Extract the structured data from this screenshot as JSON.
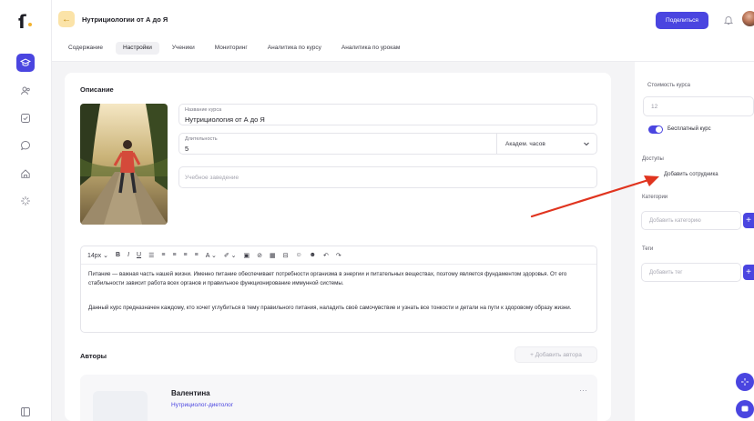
{
  "app": {
    "logo_glyph": "ſ",
    "accent_color": "#4a45e0",
    "highlight_color": "#f2b22e"
  },
  "sidebar": {
    "items": [
      {
        "icon": "graduation-cap-icon",
        "active": true
      },
      {
        "icon": "users-icon",
        "active": false
      },
      {
        "icon": "checkbox-icon",
        "active": false
      },
      {
        "icon": "chat-icon",
        "active": false
      },
      {
        "icon": "home-icon",
        "active": false
      },
      {
        "icon": "sparkles-icon",
        "active": false
      }
    ],
    "bottom_icon": "panel-toggle-icon"
  },
  "header": {
    "back_glyph": "←",
    "title": "Нутрициологии от А до Я",
    "share_label": "Поделиться",
    "bell_icon": "bell-icon",
    "avatar_icon": "user-avatar"
  },
  "tabs": [
    {
      "label": "Содержание",
      "active": false
    },
    {
      "label": "Настройки",
      "active": true
    },
    {
      "label": "Ученики",
      "active": false
    },
    {
      "label": "Мониторинг",
      "active": false
    },
    {
      "label": "Аналитика по курсу",
      "active": false
    },
    {
      "label": "Аналитика по урокам",
      "active": false
    }
  ],
  "description": {
    "section_title": "Описание",
    "course_name": {
      "label": "Название курса",
      "value": "Нутрициология от А до Я"
    },
    "duration": {
      "label": "Длительность",
      "value": "5",
      "unit": "Академ. часов"
    },
    "institution": {
      "placeholder": "Учебное заведение"
    },
    "toolbar": {
      "font_size": "14px ⌄",
      "bold": "B",
      "italic": "I",
      "underline": "U",
      "list": "☰",
      "align_left": "≡",
      "align_center": "≡",
      "align_right": "≡",
      "justify": "≡",
      "text_color": "A ⌄",
      "highlight": "✐ ⌄",
      "image": "▣",
      "link": "⊘",
      "table": "▦",
      "video": "⊟",
      "emoji1": "☺",
      "emoji2": "☻",
      "undo": "↶",
      "redo": "↷"
    },
    "text": {
      "p1": "Питание — важная часть нашей жизни. Именно питание обеспечивает потребности организма в энергии и питательных веществах, поэтому является фундаментом здоровья. От его стабильности зависит работа всех органов и правильное функционирование иммунной системы.",
      "p2": "Данный курс предназначен каждому, кто хочет углубиться в тему правильного питания, наладить своё самочувствие и узнать все тонкости и детали на пути к здоровому образу жизни."
    }
  },
  "authors": {
    "section_title": "Авторы",
    "add_label": "+ Добавить автора",
    "items": [
      {
        "name": "Валентина",
        "role": "Нутрициолог-диетолог",
        "more": "···"
      }
    ]
  },
  "right_panel": {
    "price": {
      "label": "Стоимость курса",
      "value": "12"
    },
    "free_course": {
      "label": "Бесплатный курс",
      "checked": true
    },
    "access": {
      "label": "Доступы",
      "add_employee": "Добавить сотрудника"
    },
    "categories": {
      "label": "Категории",
      "placeholder": "Добавить категорию",
      "plus": "+"
    },
    "tags": {
      "label": "Теги",
      "placeholder": "Добавить тег",
      "plus": "+"
    }
  },
  "annotation": {
    "arrow_color": "#e0341f"
  }
}
